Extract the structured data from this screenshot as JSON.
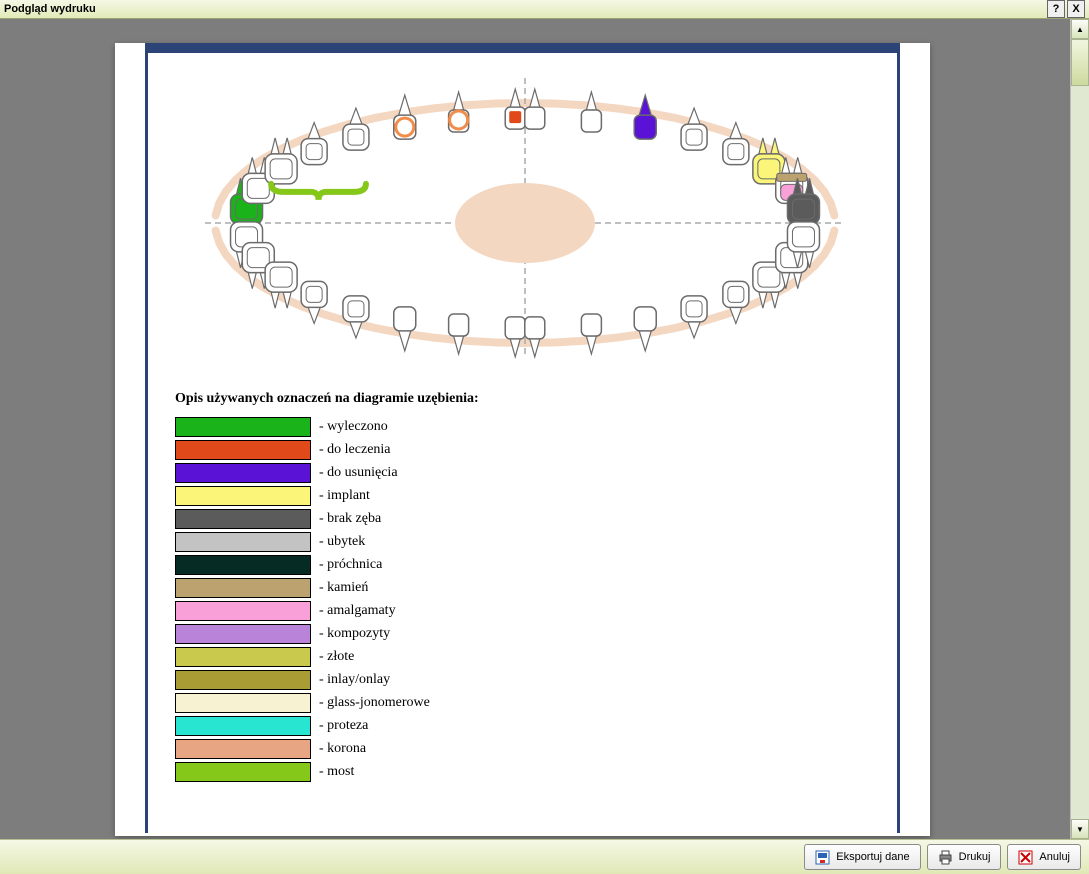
{
  "titlebar": {
    "title": "Podgląd wydruku",
    "help": "?",
    "close": "X"
  },
  "legend": {
    "title": "Opis używanych oznaczeń na diagramie uzębienia:",
    "items": [
      {
        "color": "#1ab31a",
        "label": "- wyleczono"
      },
      {
        "color": "#e04a1a",
        "label": "- do leczenia"
      },
      {
        "color": "#5a12d6",
        "label": "- do usunięcia"
      },
      {
        "color": "#fbf67a",
        "label": "- implant"
      },
      {
        "color": "#5b5b5b",
        "label": "- brak zęba"
      },
      {
        "color": "#c3c3c3",
        "label": "- ubytek"
      },
      {
        "color": "#062b24",
        "label": "- próchnica"
      },
      {
        "color": "#bba26e",
        "label": "- kamień"
      },
      {
        "color": "#f9a0d9",
        "label": "- amalgamaty"
      },
      {
        "color": "#b983d9",
        "label": "- kompozyty"
      },
      {
        "color": "#c9c94e",
        "label": "- złote"
      },
      {
        "color": "#a99c35",
        "label": "- inlay/onlay"
      },
      {
        "color": "#f7f3d2",
        "label": "- glass-jonomerowe"
      },
      {
        "color": "#27e5d1",
        "label": "- proteza"
      },
      {
        "color": "#e8a583",
        "label": "- korona"
      },
      {
        "color": "#86c81a",
        "label": "- most"
      }
    ]
  },
  "footer": {
    "export": "Eksportuj dane",
    "print": "Drukuj",
    "cancel": "Anuluj"
  },
  "diagram": {
    "upper_left": [
      {
        "n": 18,
        "type": "molar",
        "fill": "#1ab31a"
      },
      {
        "n": 17,
        "type": "molar",
        "fill": "none"
      },
      {
        "n": 16,
        "type": "molar",
        "fill": "none"
      },
      {
        "n": 15,
        "type": "premolar",
        "fill": "none"
      },
      {
        "n": 14,
        "type": "premolar",
        "fill": "none"
      },
      {
        "n": 13,
        "type": "canine",
        "fill": "none",
        "ring": "orange"
      },
      {
        "n": 12,
        "type": "incisor",
        "fill": "none",
        "ring": "orange"
      },
      {
        "n": 11,
        "type": "incisor",
        "fill": "none",
        "center": "#e04a1a"
      }
    ],
    "upper_right": [
      {
        "n": 21,
        "type": "incisor",
        "fill": "none"
      },
      {
        "n": 22,
        "type": "incisor",
        "fill": "none"
      },
      {
        "n": 23,
        "type": "canine",
        "fill": "#5a12d6"
      },
      {
        "n": 24,
        "type": "premolar",
        "fill": "none"
      },
      {
        "n": 25,
        "type": "premolar",
        "fill": "none"
      },
      {
        "n": 26,
        "type": "molar",
        "fill": "#fbf67a"
      },
      {
        "n": 27,
        "type": "molar",
        "fill": "none",
        "crown": "#f9a0d9",
        "neck": "#bba26e"
      },
      {
        "n": 28,
        "type": "molar",
        "fill": "#5b5b5b"
      }
    ],
    "lower_left": [
      {
        "n": 48,
        "type": "molar"
      },
      {
        "n": 47,
        "type": "molar"
      },
      {
        "n": 46,
        "type": "molar"
      },
      {
        "n": 45,
        "type": "premolar"
      },
      {
        "n": 44,
        "type": "premolar"
      },
      {
        "n": 43,
        "type": "canine"
      },
      {
        "n": 42,
        "type": "incisor"
      },
      {
        "n": 41,
        "type": "incisor"
      }
    ],
    "lower_right": [
      {
        "n": 31,
        "type": "incisor"
      },
      {
        "n": 32,
        "type": "incisor"
      },
      {
        "n": 33,
        "type": "canine"
      },
      {
        "n": 34,
        "type": "premolar"
      },
      {
        "n": 35,
        "type": "premolar"
      },
      {
        "n": 36,
        "type": "molar"
      },
      {
        "n": 37,
        "type": "molar"
      },
      {
        "n": 38,
        "type": "molar"
      }
    ],
    "bridge": {
      "from": 16,
      "to": 14,
      "color": "#86c81a"
    }
  }
}
